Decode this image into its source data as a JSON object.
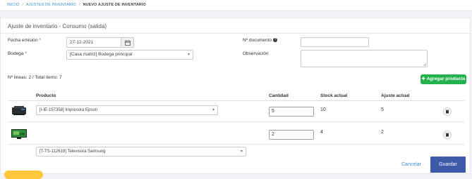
{
  "breadcrumb": {
    "home": "INICIO",
    "section": "AJUSTES DE INVENTARIO",
    "current": "NUEVO AJUSTE DE INVENTARIO"
  },
  "form": {
    "title": "Ajuste de inventario - Consumo (salida)",
    "fecha_label": "Fecha emisión",
    "fecha_value": "27-12-2021",
    "bodega_label": "Bodega",
    "bodega_value": "[Casa matriz] Bodega principal",
    "documento_label": "Nº documento",
    "documento_value": "",
    "observacion_label": "Observación",
    "observacion_value": "",
    "required_mark": "*"
  },
  "summary": {
    "counts": "Nº lineas: 2 / Total items: 7",
    "add_button": "Agregar producto"
  },
  "table": {
    "headers": {
      "producto": "Producto",
      "cantidad": "Cantidad",
      "stock": "Stock actual",
      "ajuste": "Ajuste actual"
    },
    "rows": [
      {
        "producto": "[I-IE-157358] Impresora Epson",
        "cantidad": "5",
        "stock": "10",
        "ajuste": "5"
      },
      {
        "producto": "[T-TS-112618] Televisora Samsung",
        "cantidad": "2",
        "stock": "4",
        "ajuste": "2"
      }
    ]
  },
  "actions": {
    "cancel": "Cancelar",
    "save": "Guardar"
  },
  "colors": {
    "accent": "#3b8fd6",
    "success": "#26b14f",
    "primary": "#3d5aa8",
    "required": "#e03b3b"
  }
}
